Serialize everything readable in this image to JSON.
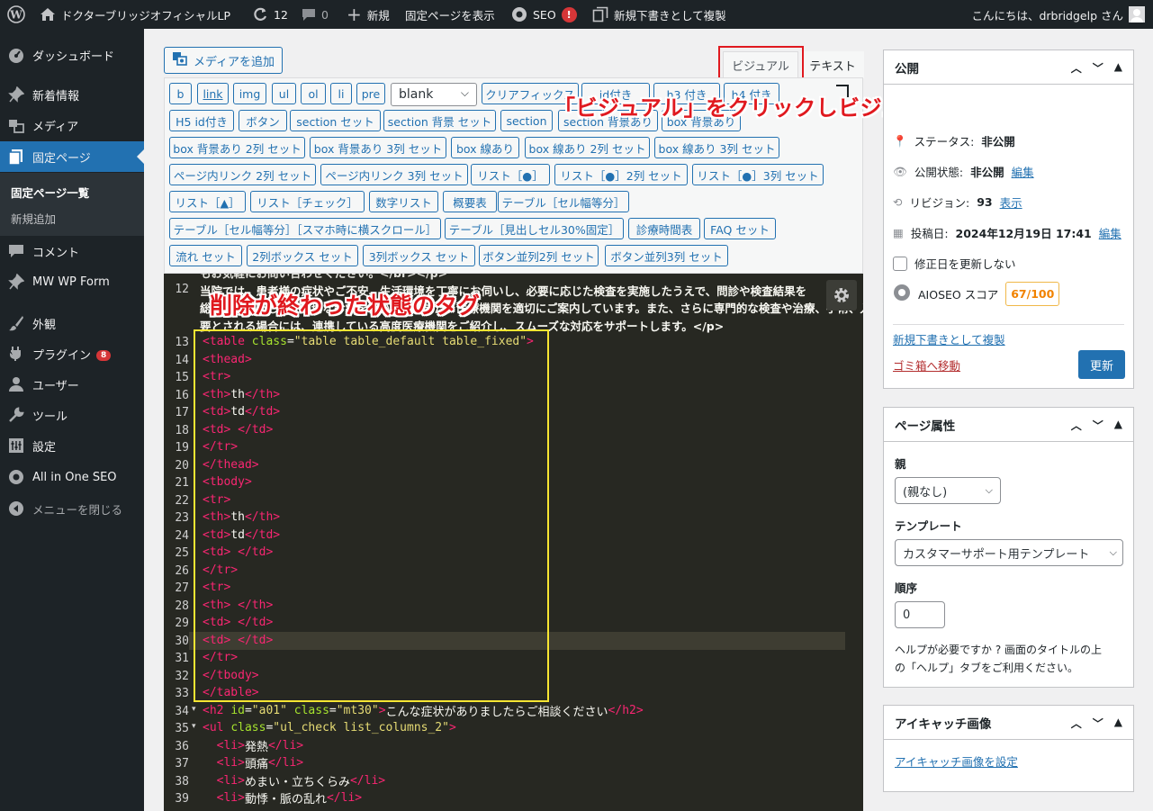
{
  "adminbar": {
    "site_name": "ドクターブリッジオフィシャルLP",
    "updates": "12",
    "comments": "0",
    "new": "新規",
    "view_page": "固定ページを表示",
    "seo": "SEO",
    "seo_badge": "!",
    "duplicate": "新規下書きとして複製",
    "greeting": "こんにちは、drbridgelp さん"
  },
  "sidebar": {
    "items": [
      {
        "label": "ダッシュボード",
        "icon": "dashboard-icon"
      },
      {
        "label": "新着情報",
        "icon": "pin-icon"
      },
      {
        "label": "メディア",
        "icon": "media-icon"
      },
      {
        "label": "固定ページ",
        "icon": "pages-icon"
      },
      {
        "label": "コメント",
        "icon": "comment-icon"
      },
      {
        "label": "MW WP Form",
        "icon": "pin-icon"
      },
      {
        "label": "外観",
        "icon": "brush-icon"
      },
      {
        "label": "プラグイン",
        "icon": "plugin-icon",
        "badge": "8"
      },
      {
        "label": "ユーザー",
        "icon": "user-icon"
      },
      {
        "label": "ツール",
        "icon": "wrench-icon"
      },
      {
        "label": "設定",
        "icon": "settings-icon"
      },
      {
        "label": "All in One SEO",
        "icon": "aioseo-icon"
      },
      {
        "label": "メニューを閉じる",
        "icon": "collapse-icon"
      }
    ],
    "submenu": [
      "固定ページ一覧",
      "新規追加"
    ]
  },
  "editor": {
    "add_media": "メディアを追加",
    "tab_visual": "ビジュアル",
    "tab_text": "テキスト",
    "select_value": "blank",
    "quicktags": [
      [
        "b",
        "link",
        "img",
        "ul",
        "ol",
        "li",
        "pre"
      ],
      [
        "クリアフィックス",
        "id付き",
        "h3 付き",
        "h4 付き"
      ],
      [
        "H5 id付き",
        "ボタン",
        "section セット",
        "section 背景 セット",
        "section",
        "section 背景あり",
        "box 背景あり"
      ],
      [
        "box 背景あり 2列 セット",
        "box 背景あり 3列 セット",
        "box 線あり",
        "box 線あり 2列 セット",
        "box 線あり 3列 セット"
      ],
      [
        "ページ内リンク 2列 セット",
        "ページ内リンク 3列 セット",
        "リスト［●］",
        "リスト［●］2列 セット",
        "リスト［●］3列 セット"
      ],
      [
        "リスト［▲］",
        "リスト［チェック］",
        "数字リスト",
        "概要表",
        "テーブル［セル幅等分］"
      ],
      [
        "テーブル［セル幅等分］［スマホ時に横スクロール］",
        "テーブル［見出しセル30%固定］",
        "診療時間表",
        "FAQ セット"
      ],
      [
        "流れ セット",
        "2列ボックス セット",
        "3列ボックス セット",
        "ボタン並列2列 セット",
        "ボタン並列3列 セット"
      ]
    ],
    "line11_text": "もお気軽にお問い合わせください。</br></p>",
    "line12_num": "12",
    "line12_text_a": "当院では、患者様の症状やご不安、生活環境を丁寧にお伺いし、必要に応じた検査を実施したうえで、問診や検査結果を",
    "line12_text_b": "総合的に判断して、適切な診療を行います。また、医療機関を適切にご案内しています。また、さらに専門的な検査や治療、手術、入院が必",
    "line12_text_c": "要とされる場合には、連携している高度医療機関をご紹介し、スムーズな対応をサポートします。</p>"
  },
  "annotations": {
    "red_caption": "「ビジュアル」をクリックしビジュアルモードへ切り替え",
    "tag_caption": "削除が終わった状態のタグ"
  },
  "publish": {
    "title": "公開",
    "status_label": "ステータス:",
    "status_value": "非公開",
    "visibility_label": "公開状態:",
    "visibility_value": "非公開",
    "visibility_edit": "編集",
    "revision_label": "リビジョン:",
    "revision_value": "93",
    "revision_link": "表示",
    "date_label": "投稿日:",
    "date_value": "2024年12月19日 17:41",
    "date_edit": "編集",
    "update_date_checkbox": "修正日を更新しない",
    "aioseo_label": "AIOSEO スコア",
    "aioseo_score": "67/100",
    "duplicate_link": "新規下書きとして複製",
    "trash_link": "ゴミ箱へ移動",
    "update_button": "更新"
  },
  "page_attributes": {
    "title": "ページ属性",
    "parent_label": "親",
    "parent_value": "(親なし)",
    "template_label": "テンプレート",
    "template_value": "カスタマーサポート用テンプレート",
    "order_label": "順序",
    "order_value": "0",
    "help_text_1": "ヘルプが必要ですか ? 画面のタイトルの上",
    "help_text_2": "の「ヘルプ」タブをご利用ください。"
  },
  "featured_image": {
    "title": "アイキャッチ画像",
    "link": "アイキャッチ画像を設定"
  },
  "code_lines": [
    {
      "n": "13",
      "parts": [
        [
          "t",
          "<table "
        ],
        [
          "a",
          "class"
        ],
        [
          "w",
          "="
        ],
        [
          "s",
          "\"table table_default table_fixed\""
        ],
        [
          "t",
          ">"
        ]
      ]
    },
    {
      "n": "14",
      "parts": [
        [
          "t",
          "<thead>"
        ]
      ]
    },
    {
      "n": "15",
      "parts": [
        [
          "t",
          "<tr>"
        ]
      ]
    },
    {
      "n": "16",
      "parts": [
        [
          "t",
          "<th>"
        ],
        [
          "w",
          "th"
        ],
        [
          "t",
          "</th>"
        ]
      ]
    },
    {
      "n": "17",
      "parts": [
        [
          "t",
          "<td>"
        ],
        [
          "w",
          "td"
        ],
        [
          "t",
          "</td>"
        ]
      ]
    },
    {
      "n": "18",
      "parts": [
        [
          "t",
          "<td> </td>"
        ]
      ]
    },
    {
      "n": "19",
      "parts": [
        [
          "t",
          "</tr>"
        ]
      ]
    },
    {
      "n": "20",
      "parts": [
        [
          "t",
          "</thead>"
        ]
      ]
    },
    {
      "n": "21",
      "parts": [
        [
          "t",
          "<tbody>"
        ]
      ]
    },
    {
      "n": "22",
      "parts": [
        [
          "t",
          "<tr>"
        ]
      ]
    },
    {
      "n": "23",
      "parts": [
        [
          "t",
          "<th>"
        ],
        [
          "w",
          "th"
        ],
        [
          "t",
          "</th>"
        ]
      ]
    },
    {
      "n": "24",
      "parts": [
        [
          "t",
          "<td>"
        ],
        [
          "w",
          "td"
        ],
        [
          "t",
          "</td>"
        ]
      ]
    },
    {
      "n": "25",
      "parts": [
        [
          "t",
          "<td> </td>"
        ]
      ]
    },
    {
      "n": "26",
      "parts": [
        [
          "t",
          "</tr>"
        ]
      ]
    },
    {
      "n": "27",
      "parts": [
        [
          "t",
          "<tr>"
        ]
      ]
    },
    {
      "n": "28",
      "parts": [
        [
          "t",
          "<th> </th>"
        ]
      ]
    },
    {
      "n": "29",
      "parts": [
        [
          "t",
          "<td> </td>"
        ]
      ]
    },
    {
      "n": "30",
      "parts": [
        [
          "t",
          "<td> </td>"
        ]
      ]
    },
    {
      "n": "31",
      "parts": [
        [
          "t",
          "</tr>"
        ]
      ]
    },
    {
      "n": "32",
      "parts": [
        [
          "t",
          "</tbody>"
        ]
      ]
    },
    {
      "n": "33",
      "parts": [
        [
          "t",
          "</table>"
        ]
      ]
    },
    {
      "n": "34",
      "parts": [
        [
          "t",
          "<h2 "
        ],
        [
          "a",
          "id"
        ],
        [
          "w",
          "="
        ],
        [
          "s",
          "\"a01\""
        ],
        [
          "w",
          " "
        ],
        [
          "a",
          "class"
        ],
        [
          "w",
          "="
        ],
        [
          "s",
          "\"mt30\""
        ],
        [
          "t",
          ">"
        ],
        [
          "w",
          "こんな症状がありましたらご相談ください"
        ],
        [
          "t",
          "</h2>"
        ]
      ]
    },
    {
      "n": "35",
      "parts": [
        [
          "t",
          "<ul "
        ],
        [
          "a",
          "class"
        ],
        [
          "w",
          "="
        ],
        [
          "s",
          "\"ul_check list_columns_2\""
        ],
        [
          "t",
          ">"
        ]
      ]
    },
    {
      "n": "36",
      "parts": [
        [
          "w",
          "  "
        ],
        [
          "t",
          "<li>"
        ],
        [
          "w",
          "発熱"
        ],
        [
          "t",
          "</li>"
        ]
      ]
    },
    {
      "n": "37",
      "parts": [
        [
          "w",
          "  "
        ],
        [
          "t",
          "<li>"
        ],
        [
          "w",
          "頭痛"
        ],
        [
          "t",
          "</li>"
        ]
      ]
    },
    {
      "n": "38",
      "parts": [
        [
          "w",
          "  "
        ],
        [
          "t",
          "<li>"
        ],
        [
          "w",
          "めまい・立ちくらみ"
        ],
        [
          "t",
          "</li>"
        ]
      ]
    },
    {
      "n": "39",
      "parts": [
        [
          "w",
          "  "
        ],
        [
          "t",
          "<li>"
        ],
        [
          "w",
          "動悸・脈の乱れ"
        ],
        [
          "t",
          "</li>"
        ]
      ]
    }
  ]
}
